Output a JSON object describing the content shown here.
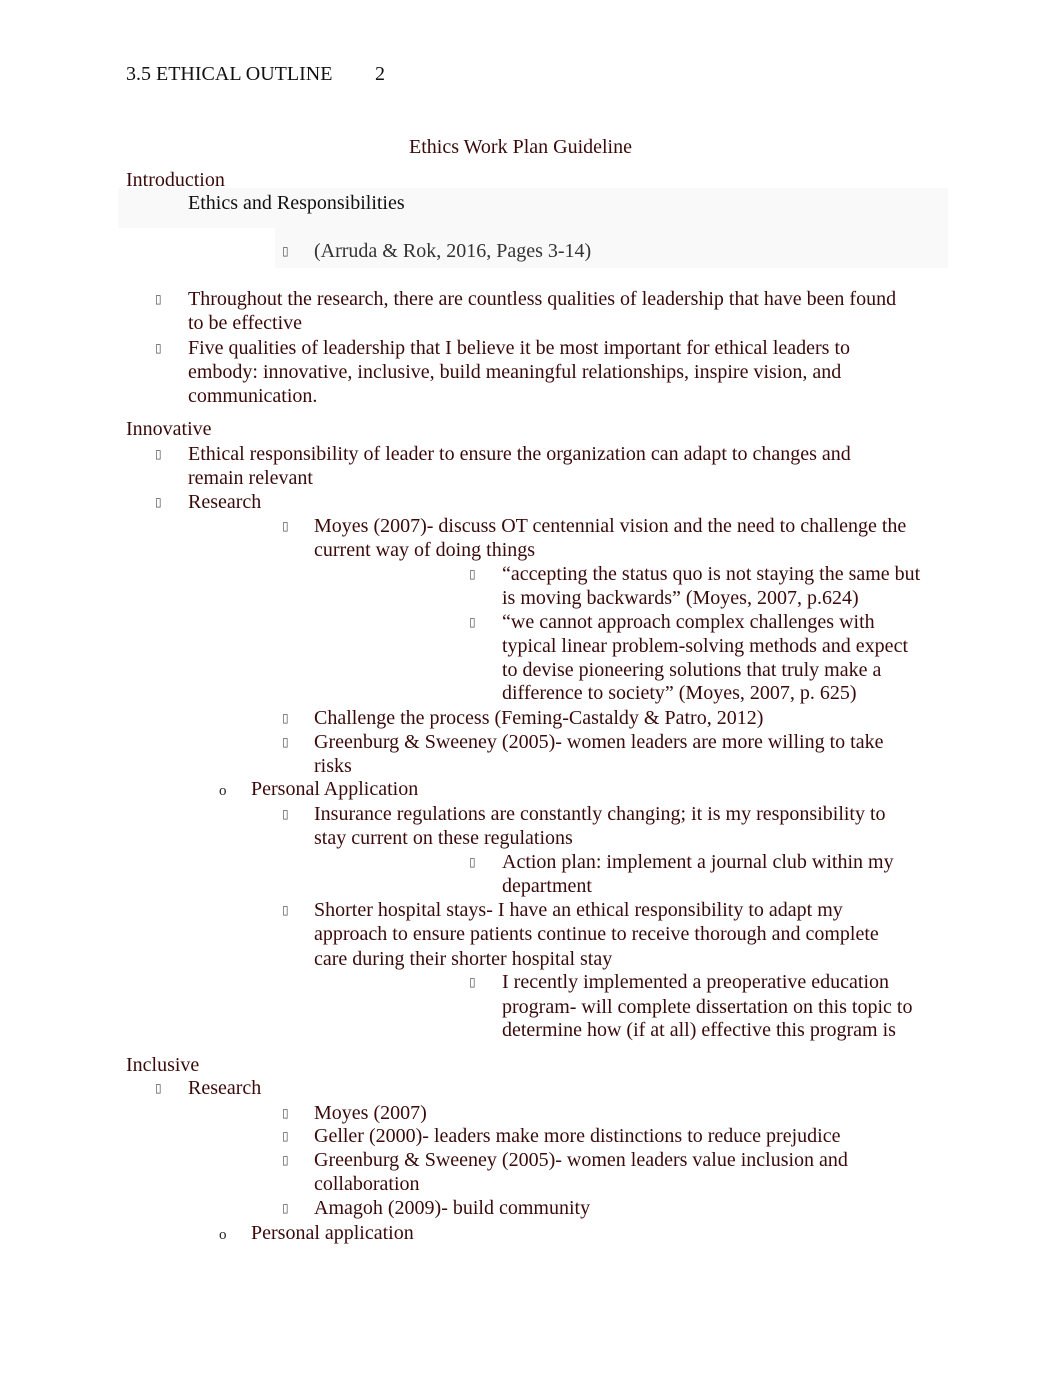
{
  "header": {
    "running_head": "3.5 ETHICAL OUTLINE",
    "page_number": "2"
  },
  "title": "Ethics Work Plan Guideline",
  "intro": {
    "heading": "Introduction",
    "subheading": "Ethics and Responsibilities",
    "citation": "(Arruda & Rok, 2016, Pages 3-14)",
    "bullets": [
      [
        "Throughout the research, there are countless qualities of leadership that have been found",
        "to be effective"
      ],
      [
        "Five qualities of leadership that I believe it be most important for ethical leaders to",
        "embody: innovative, inclusive, build meaningful relationships, inspire vision, and",
        "communication."
      ]
    ]
  },
  "innovative": {
    "heading": "Innovative",
    "b1": [
      "Ethical responsibility of leader to ensure the organization can adapt to changes and",
      "remain relevant"
    ],
    "research_label": "Research",
    "moyes": [
      "Moyes (2007)- discuss OT centennial vision and the need to challenge the",
      "current way of doing things"
    ],
    "quote1": [
      "“accepting the status quo is not staying the same but",
      "is moving backwards” (Moyes, 2007, p.624)"
    ],
    "quote2": [
      "“we cannot approach complex challenges with",
      "typical linear problem-solving methods and expect",
      "to devise pioneering solutions that truly make a",
      "difference to society” (Moyes, 2007, p. 625)"
    ],
    "challenge": "Challenge the process (Feming-Castaldy & Patro, 2012)",
    "greenburg": [
      "Greenburg & Sweeney (2005)- women leaders are more willing to take",
      "risks"
    ],
    "personal_label": "Personal Application",
    "insurance": [
      "Insurance regulations are constantly changing; it is my responsibility to",
      "stay current on these regulations"
    ],
    "action_plan": [
      "Action plan: implement a journal club within my",
      "department"
    ],
    "shorter": [
      "Shorter hospital stays- I have an ethical responsibility to adapt my",
      "approach to ensure patients continue to receive thorough and complete",
      "care during their shorter hospital stay"
    ],
    "preop": [
      "I recently implemented a preoperative education",
      "program- will complete dissertation on this topic to",
      "determine how (if at all) effective this program is"
    ]
  },
  "inclusive": {
    "heading": "Inclusive",
    "research_label": "Research",
    "items": [
      [
        "Moyes (2007)"
      ],
      [
        "Geller (2000)- leaders make more distinctions to reduce prejudice"
      ],
      [
        "Greenburg & Sweeney (2005)- women leaders value inclusion and",
        "collaboration"
      ],
      [
        "Amagoh (2009)- build community"
      ]
    ],
    "personal_label": "Personal application"
  },
  "glyphs": {
    "square_bullet": "▯",
    "o_bullet": "o"
  }
}
